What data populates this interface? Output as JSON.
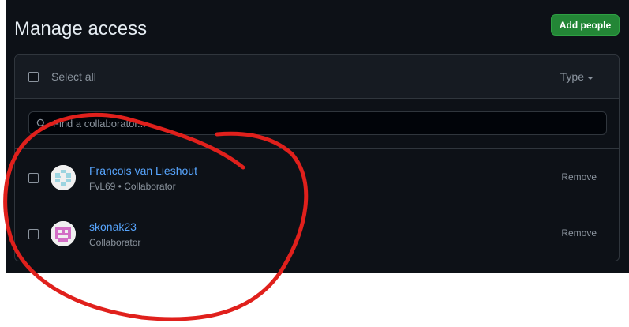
{
  "header": {
    "title": "Manage access",
    "add_button_label": "Add people"
  },
  "list": {
    "select_all_label": "Select all",
    "type_filter_label": "Type",
    "search_placeholder": "Find a collaborator...",
    "members": [
      {
        "name": "Francois van Lieshout",
        "username": "FvL69",
        "role": "Collaborator",
        "meta": "FvL69 • Collaborator",
        "remove_label": "Remove",
        "avatar_color": "#9cd4e0"
      },
      {
        "name": "skonak23",
        "role": "Collaborator",
        "meta": "Collaborator",
        "remove_label": "Remove",
        "avatar_color": "#d36fc6"
      }
    ]
  },
  "colors": {
    "background": "#0d1117",
    "header_bg": "#161b22",
    "border": "#30363d",
    "accent_button": "#238636",
    "link": "#58a6ff",
    "muted_text": "#8b949e",
    "annotation": "#e0201c"
  },
  "icons": {
    "search": "search-icon",
    "type_caret": "caret-down-icon"
  }
}
